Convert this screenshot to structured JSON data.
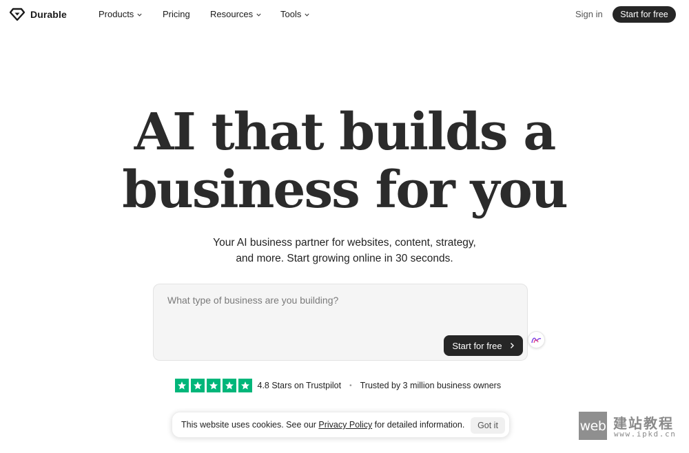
{
  "brand": {
    "name": "Durable",
    "icon": "diamond-logo-icon"
  },
  "nav": {
    "items": [
      {
        "label": "Products",
        "has_dropdown": true
      },
      {
        "label": "Pricing",
        "has_dropdown": false
      },
      {
        "label": "Resources",
        "has_dropdown": true
      },
      {
        "label": "Tools",
        "has_dropdown": true
      }
    ],
    "sign_in": "Sign in",
    "cta": "Start for free"
  },
  "hero": {
    "headline_lines": [
      "AI that builds a",
      "business for you"
    ],
    "subtitle_lines": [
      "Your AI business partner for websites, content, strategy,",
      "and more. Start growing online in 30 seconds."
    ]
  },
  "prompt": {
    "placeholder": "What type of business are you building?",
    "value": "",
    "cta": "Start for free"
  },
  "rating": {
    "stars": 5,
    "text": "4.8 Stars on Trustpilot",
    "separator": "•",
    "trust_text": "Trusted by 3 million business owners"
  },
  "cookie": {
    "text_before": "This website uses cookies. See our ",
    "link": "Privacy Policy",
    "text_after": " for detailed information.",
    "button": "Got it"
  },
  "watermark": {
    "box_text": "web",
    "cn_text": "建站教程",
    "url": "www.ipkd.cn"
  },
  "colors": {
    "primary_dark": "#262626",
    "trustpilot_green": "#00b67a",
    "prompt_bg": "#f5f5f5"
  }
}
